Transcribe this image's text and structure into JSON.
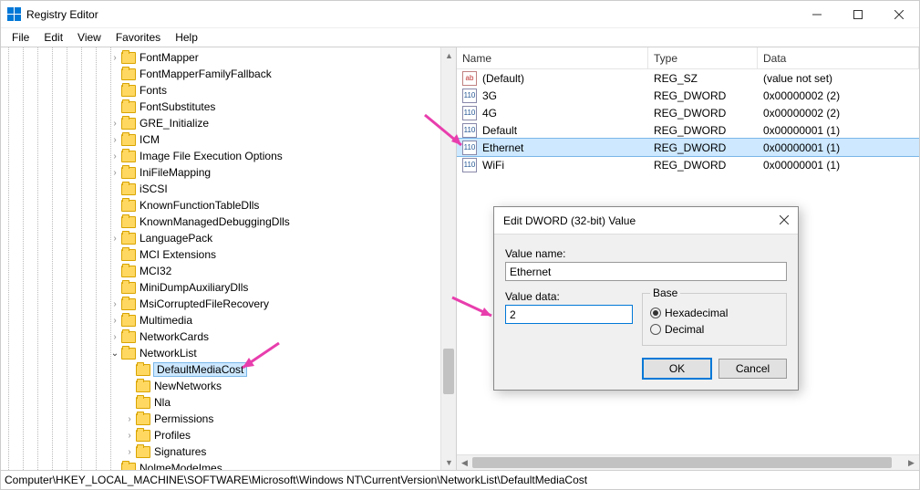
{
  "window": {
    "title": "Registry Editor"
  },
  "menu": [
    "File",
    "Edit",
    "View",
    "Favorites",
    "Help"
  ],
  "statusbar": "Computer\\HKEY_LOCAL_MACHINE\\SOFTWARE\\Microsoft\\Windows NT\\CurrentVersion\\NetworkList\\DefaultMediaCost",
  "tree": {
    "selected": "DefaultMediaCost",
    "items": [
      {
        "indent": 7,
        "label": "FontMapper",
        "expander": ">"
      },
      {
        "indent": 7,
        "label": "FontMapperFamilyFallback",
        "expander": ""
      },
      {
        "indent": 7,
        "label": "Fonts",
        "expander": ""
      },
      {
        "indent": 7,
        "label": "FontSubstitutes",
        "expander": ""
      },
      {
        "indent": 7,
        "label": "GRE_Initialize",
        "expander": ">"
      },
      {
        "indent": 7,
        "label": "ICM",
        "expander": ">"
      },
      {
        "indent": 7,
        "label": "Image File Execution Options",
        "expander": ">"
      },
      {
        "indent": 7,
        "label": "IniFileMapping",
        "expander": ">"
      },
      {
        "indent": 7,
        "label": "iSCSI",
        "expander": ""
      },
      {
        "indent": 7,
        "label": "KnownFunctionTableDlls",
        "expander": ""
      },
      {
        "indent": 7,
        "label": "KnownManagedDebuggingDlls",
        "expander": ""
      },
      {
        "indent": 7,
        "label": "LanguagePack",
        "expander": ">"
      },
      {
        "indent": 7,
        "label": "MCI Extensions",
        "expander": ""
      },
      {
        "indent": 7,
        "label": "MCI32",
        "expander": ""
      },
      {
        "indent": 7,
        "label": "MiniDumpAuxiliaryDlls",
        "expander": ""
      },
      {
        "indent": 7,
        "label": "MsiCorruptedFileRecovery",
        "expander": ">"
      },
      {
        "indent": 7,
        "label": "Multimedia",
        "expander": ">"
      },
      {
        "indent": 7,
        "label": "NetworkCards",
        "expander": ">"
      },
      {
        "indent": 7,
        "label": "NetworkList",
        "expander": "v"
      },
      {
        "indent": 8,
        "label": "DefaultMediaCost",
        "expander": "",
        "selected": true
      },
      {
        "indent": 8,
        "label": "NewNetworks",
        "expander": ""
      },
      {
        "indent": 8,
        "label": "Nla",
        "expander": ""
      },
      {
        "indent": 8,
        "label": "Permissions",
        "expander": ">"
      },
      {
        "indent": 8,
        "label": "Profiles",
        "expander": ">"
      },
      {
        "indent": 8,
        "label": "Signatures",
        "expander": ">"
      },
      {
        "indent": 7,
        "label": "NolmeModeImes",
        "expander": ""
      }
    ]
  },
  "list": {
    "columns": {
      "name": "Name",
      "type": "Type",
      "data": "Data"
    },
    "rows": [
      {
        "icon": "sz",
        "name": "(Default)",
        "type": "REG_SZ",
        "data": "(value not set)"
      },
      {
        "icon": "dw",
        "name": "3G",
        "type": "REG_DWORD",
        "data": "0x00000002 (2)"
      },
      {
        "icon": "dw",
        "name": "4G",
        "type": "REG_DWORD",
        "data": "0x00000002 (2)"
      },
      {
        "icon": "dw",
        "name": "Default",
        "type": "REG_DWORD",
        "data": "0x00000001 (1)"
      },
      {
        "icon": "dw",
        "name": "Ethernet",
        "type": "REG_DWORD",
        "data": "0x00000001 (1)",
        "selected": true
      },
      {
        "icon": "dw",
        "name": "WiFi",
        "type": "REG_DWORD",
        "data": "0x00000001 (1)"
      }
    ]
  },
  "dialog": {
    "title": "Edit DWORD (32-bit) Value",
    "valuename_label": "Value name:",
    "valuename": "Ethernet",
    "valuedata_label": "Value data:",
    "valuedata": "2",
    "base_label": "Base",
    "hex": "Hexadecimal",
    "dec": "Decimal",
    "ok": "OK",
    "cancel": "Cancel"
  }
}
